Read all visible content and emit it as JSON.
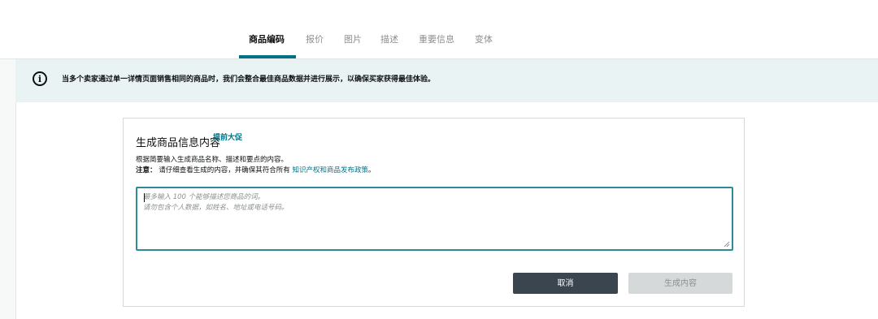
{
  "tabs": [
    {
      "label": "商品编码",
      "active": true
    },
    {
      "label": "报价",
      "active": false
    },
    {
      "label": "图片",
      "active": false
    },
    {
      "label": "描述",
      "active": false
    },
    {
      "label": "重要信息",
      "active": false
    },
    {
      "label": "变体",
      "active": false
    }
  ],
  "banner": {
    "icon": "info-icon",
    "icon_glyph": "i",
    "text": "当多个卖家通过单一详情页面销售相同的商品时，我们会整合最佳商品数据并进行展示，以确保买家获得最佳体验。"
  },
  "card": {
    "title": "生成商品信息内容",
    "title_tag": "提前大促",
    "description": "根据简要输入生成商品名称、描述和要点的内容。",
    "note_label": "注意：",
    "note_text": "请仔细查看生成的内容，并确保其符合所有",
    "note_link": "知识产权和商品发布政策",
    "note_end": "。",
    "input": {
      "value": "",
      "placeholder_line1": "最多输入 100 个能够描述您商品的词。",
      "placeholder_line2": "请勿包含个人数据，如姓名、地址或电话号码。"
    },
    "cancel_label": "取消",
    "generate_label": "生成内容"
  },
  "colors": {
    "accent": "#007185",
    "banner_bg": "#e9f3f3",
    "input_border": "#2e8a96",
    "cancel_bg": "#3b4550",
    "disabled_bg": "#d5d9d9"
  }
}
